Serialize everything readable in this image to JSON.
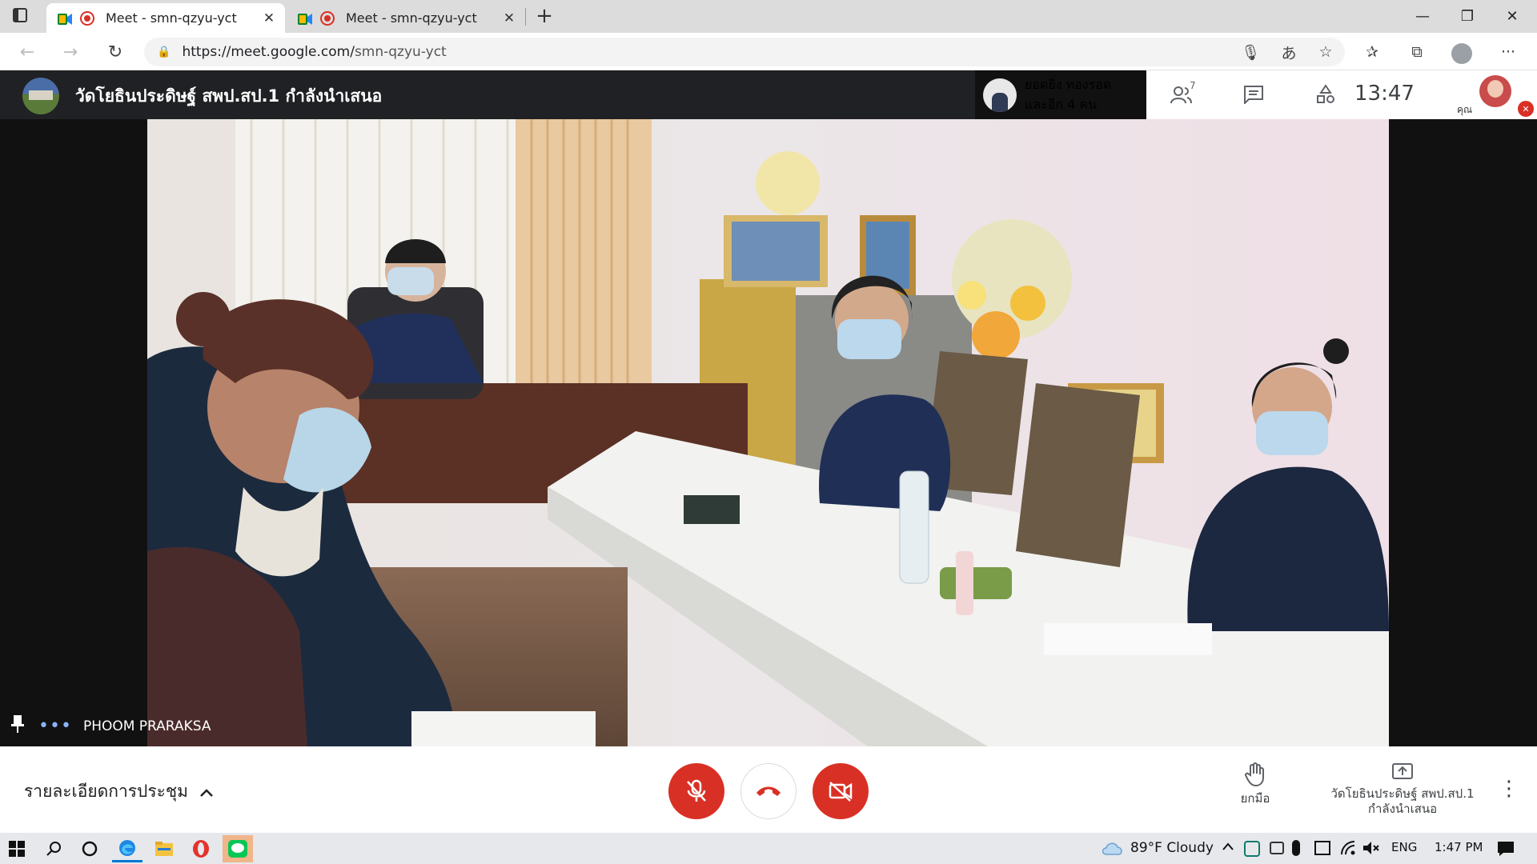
{
  "browser": {
    "tabs": [
      {
        "title": "Meet - smn-qzyu-yct",
        "active": true
      },
      {
        "title": "Meet - smn-qzyu-yct",
        "active": false
      }
    ],
    "url_host": "https://meet.google.com/",
    "url_path": "smn-qzyu-yct",
    "icons": {
      "tab_actions": "tab-actions-icon",
      "new_tab": "+",
      "back": "←",
      "forward": "→",
      "refresh": "↻",
      "lock": "🔒",
      "mic": "🎙",
      "read_aloud": "あ",
      "add_favorite": "☆",
      "favorites": "✰",
      "collections": "⧉",
      "profile": "●",
      "more": "···"
    },
    "window_controls": {
      "minimize": "—",
      "restore": "❐",
      "close": "✕"
    }
  },
  "meet": {
    "presenter_title": "วัดโยธินประดิษฐ์ สพป.สป.1 กำลังนำเสนอ",
    "active_speaker_line1": "ยอดยิ่ง ทองรอด",
    "active_speaker_line2": "และอีก 4 คน",
    "participant_count": "7",
    "clock": "13:47",
    "you_label": "คุณ",
    "participant_name": "PHOOM PRARAKSA",
    "meeting_details": "รายละเอียดการประชุม",
    "raise_hand": "ยกมือ",
    "presenting_line1": "วัดโยธินประดิษฐ์ สพป.สป.1",
    "presenting_line2": "กำลังนำเสนอ",
    "icons": {
      "people": "👥",
      "chat": "▤",
      "activities": "△",
      "pin": "📌",
      "more_dots": "•••",
      "chevron_up": "⌃",
      "mic_off": "🎙",
      "hangup": "☎",
      "cam_off": "📹",
      "hand": "✋",
      "present": "⬆",
      "kebab": "⋮"
    },
    "colors": {
      "control_red": "#d93025",
      "header": "#202124",
      "accent_blue": "#8ab4f8"
    }
  },
  "taskbar": {
    "weather": "89°F  Cloudy",
    "lang": "ENG",
    "time": "1:47 PM",
    "icons": {
      "start": "⊞",
      "search": "⌕",
      "cortana": "○",
      "edge": "e",
      "files": "▆",
      "opera": "O",
      "line": "L",
      "chevron": "⌃",
      "notifications": "▭"
    }
  }
}
